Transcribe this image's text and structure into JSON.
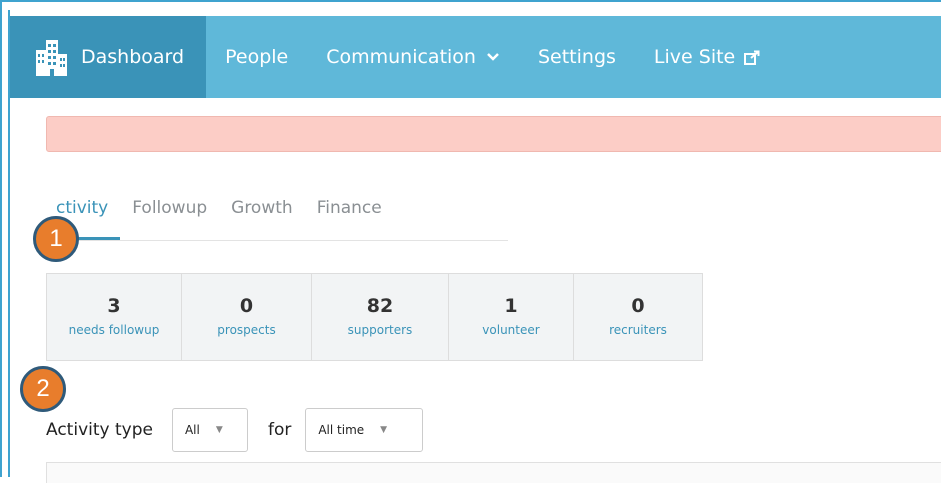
{
  "nav": {
    "brand_label": "Dashboard",
    "items": [
      {
        "label": "People"
      },
      {
        "label": "Communication"
      },
      {
        "label": "Settings"
      },
      {
        "label": "Live Site"
      }
    ],
    "color": "#5fb8d9",
    "active_color": "#3a93b8"
  },
  "tabs": [
    {
      "label": "Activity",
      "visible_label": "ctivity",
      "active": true
    },
    {
      "label": "Followup"
    },
    {
      "label": "Growth"
    },
    {
      "label": "Finance"
    }
  ],
  "stats": [
    {
      "value": "3",
      "label": "needs followup"
    },
    {
      "value": "0",
      "label": "prospects"
    },
    {
      "value": "82",
      "label": "supporters"
    },
    {
      "value": "1",
      "label": "volunteer"
    },
    {
      "value": "0",
      "label": "recruiters"
    }
  ],
  "filters": {
    "activity_type_label": "Activity type",
    "activity_type_value": "All",
    "for_label": "for",
    "time_value": "All time"
  },
  "annotations": [
    "1",
    "2"
  ],
  "alert_color": "#fccdc6",
  "badge_color": "#e87d2c"
}
